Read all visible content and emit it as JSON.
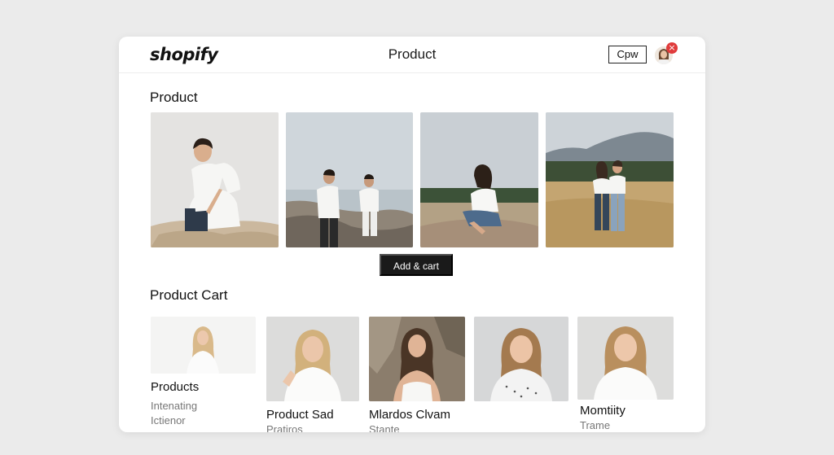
{
  "header": {
    "logo": "shopify",
    "title": "Product",
    "button_label": "Cpw",
    "close_glyph": "×"
  },
  "gallery": {
    "heading": "Product",
    "add_to_cart_label": "Add & cart",
    "images": [
      {
        "icon": "man-sitting-on-blanket-photo"
      },
      {
        "icon": "two-men-on-rocks-photo"
      },
      {
        "icon": "woman-sitting-on-rock-photo"
      },
      {
        "icon": "couple-in-field-photo"
      }
    ]
  },
  "cart": {
    "heading": "Product Cart",
    "cards": [
      {
        "title": "Products",
        "lines": [
          "Intenating",
          "Ictienor"
        ]
      },
      {
        "title": "Product Sad",
        "lines": [
          "Pratiros"
        ]
      },
      {
        "title": "Mlardos Clvam",
        "lines": [
          "Stante"
        ]
      },
      {
        "title": "",
        "lines": []
      },
      {
        "title": "Momtiity",
        "lines": [
          "Trame"
        ]
      }
    ]
  },
  "colors": {
    "page_background": "#ebebeb",
    "panel": "#ffffff",
    "primary_button": "#1a1a1a",
    "close_badge": "#e03b3b"
  }
}
